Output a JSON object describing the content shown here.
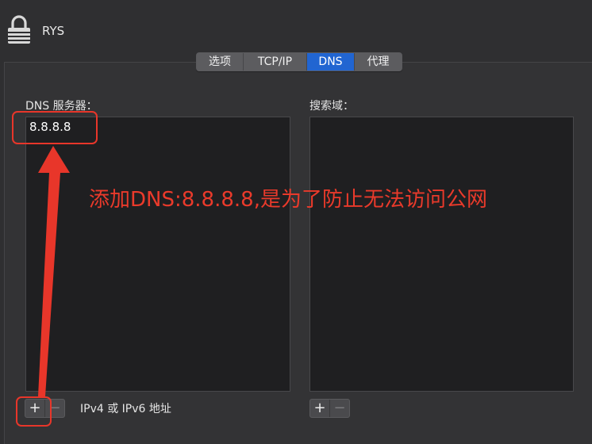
{
  "header": {
    "network_name": "RYS"
  },
  "tabs": [
    {
      "label": "选项",
      "active": false
    },
    {
      "label": "TCP/IP",
      "active": false
    },
    {
      "label": "DNS",
      "active": true
    },
    {
      "label": "代理",
      "active": false
    }
  ],
  "dns_servers": {
    "label": "DNS 服务器：",
    "entries": [
      "8.8.8.8"
    ]
  },
  "search_domains": {
    "label": "搜索域：",
    "entries": []
  },
  "buttons": {
    "add": "+",
    "remove": "−"
  },
  "hint": "IPv4 或 IPv6 地址",
  "annotation": {
    "text": "添加DNS:8.8.8.8,是为了防止无法访问公网",
    "color": "#ea3a2b"
  },
  "colors": {
    "accent": "#2165d1",
    "annotation": "#e8362a"
  }
}
